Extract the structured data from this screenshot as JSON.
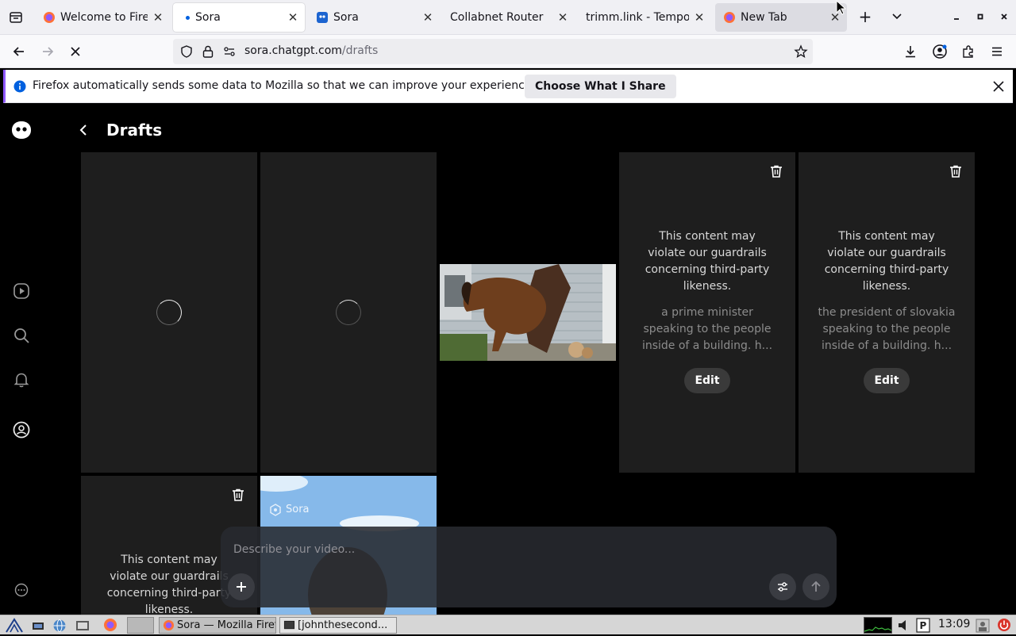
{
  "browser": {
    "tabs": [
      {
        "title": "Welcome to Firefox",
        "favicon": "firefox-icon",
        "state": "normal"
      },
      {
        "title": "Sora",
        "favicon": "dot-icon",
        "state": "active"
      },
      {
        "title": "Sora",
        "favicon": "sora-icon",
        "state": "normal"
      },
      {
        "title": "Collabnet Router",
        "favicon": "",
        "state": "normal"
      },
      {
        "title": "trimm.link - Temporary",
        "favicon": "",
        "state": "normal"
      },
      {
        "title": "New Tab",
        "favicon": "firefox-icon",
        "state": "hovered"
      }
    ],
    "url": {
      "host": "sora.chatgpt.com",
      "path": "/drafts"
    },
    "notification": {
      "message": "Firefox automatically sends some data to Mozilla so that we can improve your experience.",
      "button": "Choose What I Share"
    }
  },
  "page": {
    "back_label": "<",
    "title": "Drafts",
    "drafts": [
      {
        "kind": "loading"
      },
      {
        "kind": "loading"
      },
      {
        "kind": "video",
        "description": "horse bursting through house wall"
      },
      {
        "kind": "blocked",
        "warning": "This content may violate our guardrails concerning third-party likeness.",
        "prompt": "a prime minister speaking to the people inside of a building. h...",
        "edit_label": "Edit"
      },
      {
        "kind": "blocked",
        "warning": "This content may violate our guardrails concerning third-party likeness.",
        "prompt": "the president of slovakia speaking to the people inside of a building. h...",
        "edit_label": "Edit"
      },
      {
        "kind": "blocked",
        "warning": "This content may violate our guardrails concerning third-party likeness."
      },
      {
        "kind": "video",
        "watermark": "Sora"
      }
    ],
    "composer": {
      "placeholder": "Describe your video..."
    }
  },
  "taskbar": {
    "windows": [
      {
        "title": "Sora — Mozilla Firefox",
        "state": "active"
      },
      {
        "title": "[johnthesecond...",
        "state": "normal"
      }
    ],
    "clock": "13:09"
  }
}
